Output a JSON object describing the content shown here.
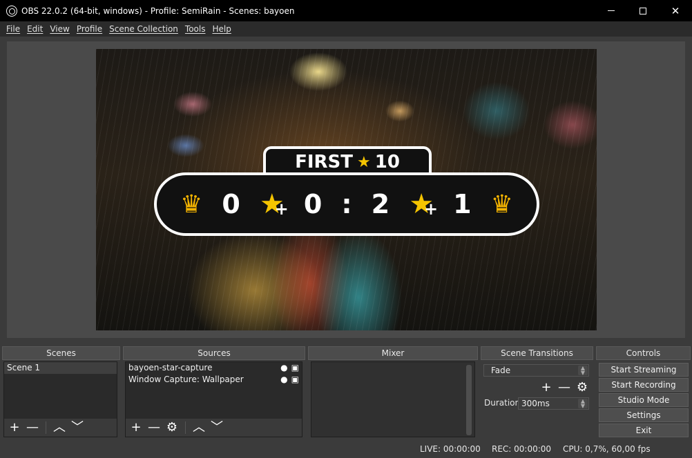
{
  "window": {
    "title": "OBS 22.0.2 (64-bit, windows) - Profile: SemiRain - Scenes: bayoen",
    "controls": {
      "minimize": "",
      "maximize": "",
      "close": "✕"
    }
  },
  "menu": [
    "File",
    "Edit",
    "View",
    "Profile",
    "Scene Collection",
    "Tools",
    "Help"
  ],
  "preview": {
    "overlay_title": "FIRST",
    "overlay_target": "10",
    "score_left_stars": "0",
    "score_left": "0",
    "score_sep": ":",
    "score_right": "2",
    "score_right_stars": "1"
  },
  "docks": {
    "scenes_title": "Scenes",
    "sources_title": "Sources",
    "mixer_title": "Mixer",
    "transitions_title": "Scene Transitions",
    "controls_title": "Controls"
  },
  "scenes": [
    "Scene 1"
  ],
  "sources": [
    "bayoen-star-capture",
    "Window Capture: Wallpaper"
  ],
  "transitions": {
    "selected": "Fade",
    "duration_label": "Duration",
    "duration_value": "300ms"
  },
  "controls": [
    "Start Streaming",
    "Start Recording",
    "Studio Mode",
    "Settings",
    "Exit"
  ],
  "status": {
    "live": "LIVE: 00:00:00",
    "rec": "REC: 00:00:00",
    "cpu": "CPU: 0,7%, 60,00 fps"
  },
  "icons": {
    "add": "+",
    "remove": "—",
    "gear": "⚙",
    "up": "︿",
    "down": "﹀",
    "eye": "👁",
    "lock": "🔒",
    "star": "★",
    "crown": "♛"
  }
}
